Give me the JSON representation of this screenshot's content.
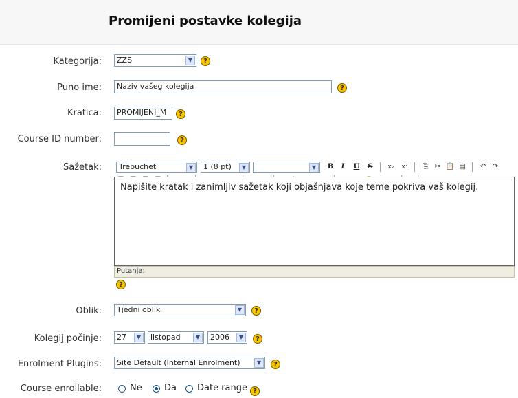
{
  "page": {
    "title": "Promijeni postavke kolegija"
  },
  "form": {
    "category": {
      "label": "Kategorija:",
      "value": "ZZS"
    },
    "fullname": {
      "label": "Puno ime:",
      "value": "Naziv vašeg kolegija"
    },
    "shortname": {
      "label": "Kratica:",
      "value": "PROMIJENI_M"
    },
    "idnumber": {
      "label": "Course ID number:",
      "value": ""
    },
    "summary": {
      "label": "Sažetak:",
      "font": "Trebuchet",
      "size": "1 (8 pt)",
      "style": "",
      "text": "Napišite kratak i zanimljiv sažetak koji objašnjava koje teme pokriva vaš kolegij.",
      "path_label": "Putanja:"
    },
    "format": {
      "label": "Oblik:",
      "value": "Tjedni oblik"
    },
    "startdate": {
      "label": "Kolegij počinje:",
      "day": "27",
      "month": "listopad",
      "year": "2006"
    },
    "enrol": {
      "label": "Enrolment Plugins:",
      "value": "Site Default (Internal Enrolment)"
    },
    "enrollable": {
      "label": "Course enrollable:",
      "options": [
        "Ne",
        "Da",
        "Date range"
      ],
      "selected": "Da"
    }
  },
  "icons": {
    "help": "help-icon",
    "arrow": "chevron-down-icon"
  },
  "colors": {
    "help_bg": "#f5c400",
    "border": "#7f9db9"
  }
}
